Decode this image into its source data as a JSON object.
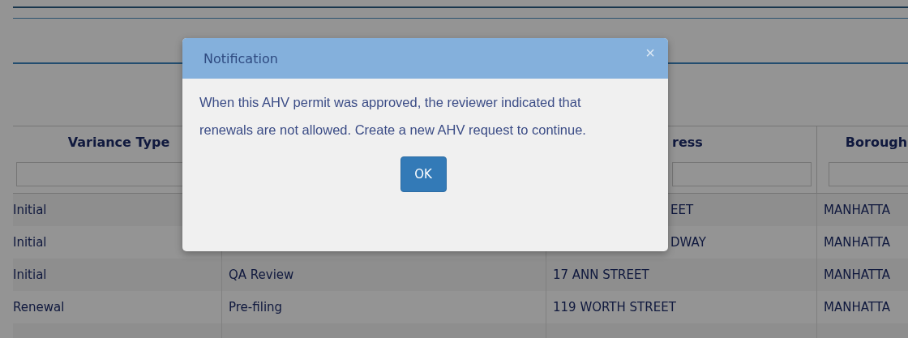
{
  "table": {
    "columns": [
      "Variance Type",
      null,
      "ress",
      "Borough"
    ],
    "rows": [
      [
        "Initial",
        null,
        "EET",
        "MANHATTA"
      ],
      [
        "Initial",
        null,
        "DWAY",
        "MANHATTA"
      ],
      [
        "Initial",
        "QA Review",
        "17 ANN STREET",
        "MANHATTA"
      ],
      [
        "Renewal",
        "Pre-filing",
        "119 WORTH STREET",
        "MANHATTA"
      ]
    ]
  },
  "dialog": {
    "title": "Notification",
    "close": "×",
    "message": "When this AHV permit was approved, the reviewer indicated that renewals are not allowed. Create a new AHV request to continue.",
    "button": "OK"
  }
}
